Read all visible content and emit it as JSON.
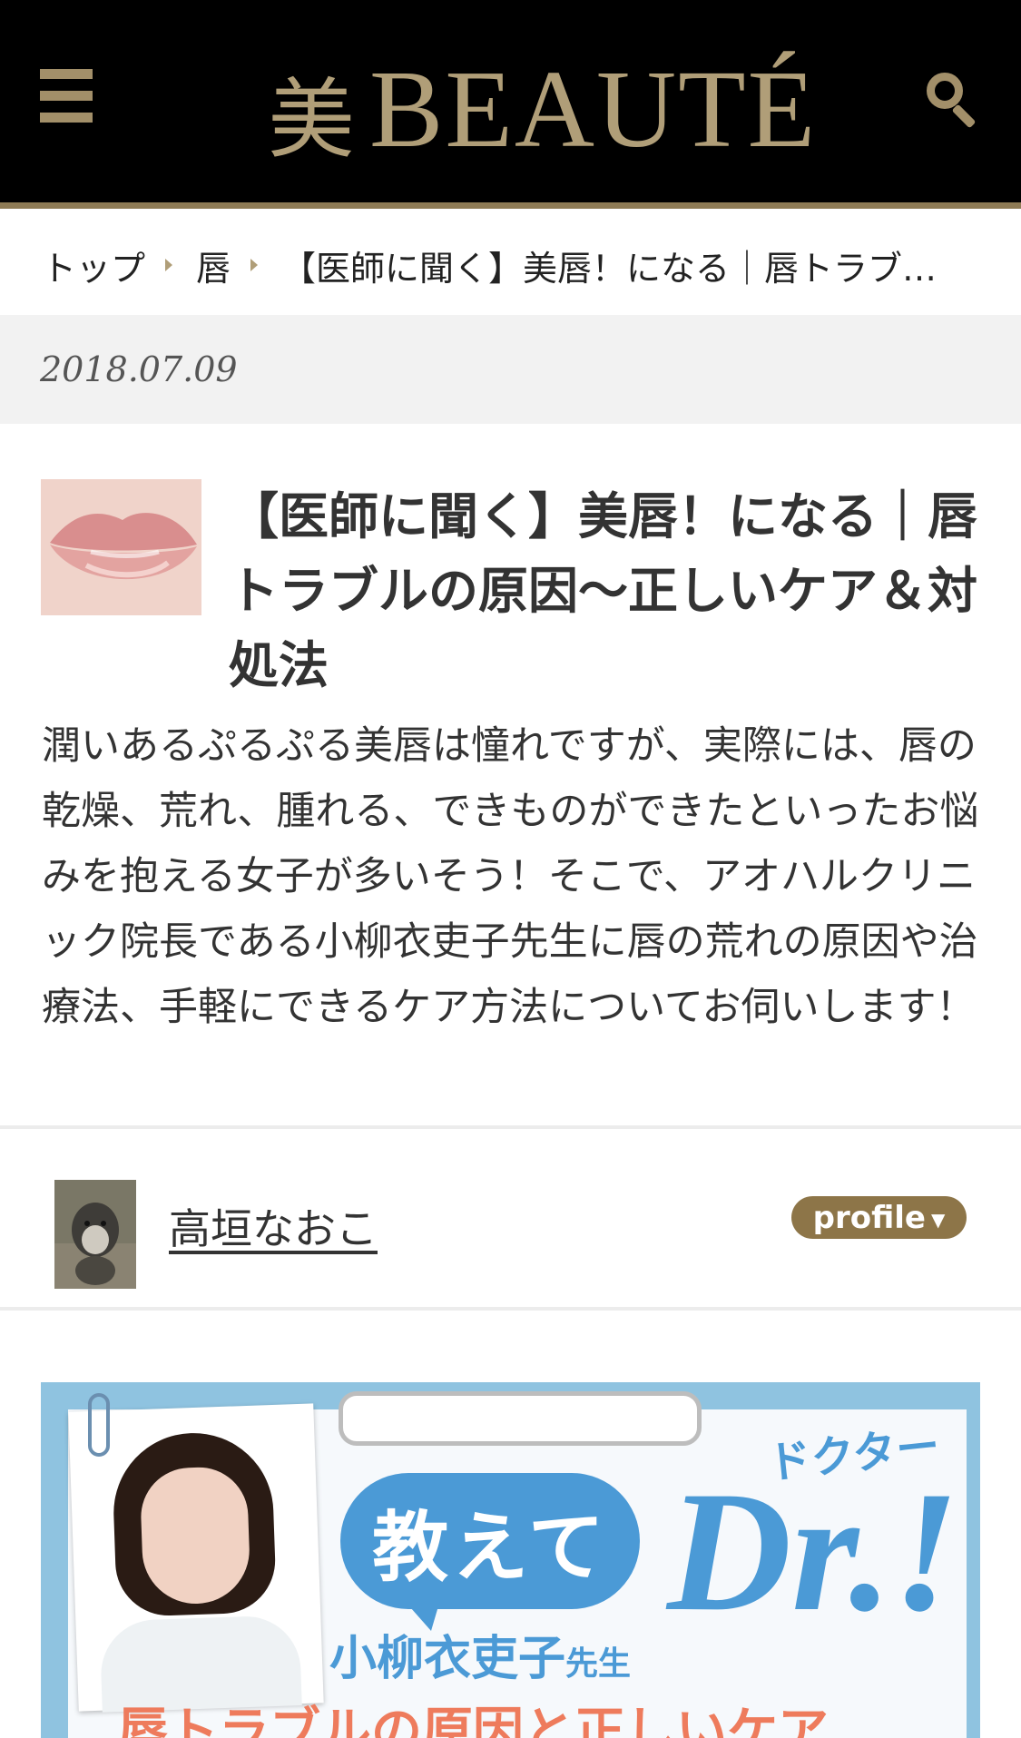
{
  "header": {
    "logo_kanji": "美",
    "logo_latin": "BEAUTÉ",
    "menu_icon": "hamburger-menu-icon",
    "search_icon": "search-icon",
    "accent": "#a28f69",
    "background": "#000000"
  },
  "breadcrumb": {
    "items": [
      "トップ",
      "唇"
    ],
    "current": "【医師に聞く】美唇！になる｜唇トラブ…"
  },
  "article": {
    "date": "2018.07.09",
    "title": "【医師に聞く】美唇！になる｜唇トラブルの原因〜正しいケア＆対処法",
    "lead": "潤いあるぷるぷる美唇は憧れですが、実際には、唇の乾燥、荒れ、腫れる、できものができたといったお悩みを抱える女子が多いそう！そこで、アオハルクリニック院長である小柳衣吏子先生に唇の荒れの原因や治療法、手軽にできるケア方法についてお伺いします！"
  },
  "author": {
    "name": "高垣なおこ",
    "profile_label": "profile",
    "profile_color": "#8d7548"
  },
  "banner": {
    "bubble_text": "教えて",
    "dr_text": "Dr.!",
    "doctor_kana": "ドクター",
    "sensei_name": "小柳衣吏子",
    "sensei_suffix": "先生",
    "subtitle": "唇トラブルの原因と正しいケア"
  }
}
